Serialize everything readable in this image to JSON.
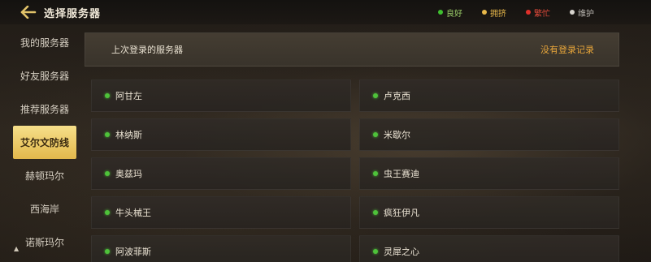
{
  "header": {
    "title": "选择服务器",
    "legend": [
      {
        "label": "良好",
        "color": "#3fbf2f"
      },
      {
        "label": "拥挤",
        "color": "#e8b84a"
      },
      {
        "label": "繁忙",
        "color": "#e0302a"
      },
      {
        "label": "维护",
        "color": "#d8d4ce"
      }
    ]
  },
  "sidebar": {
    "items": [
      {
        "label": "我的服务器"
      },
      {
        "label": "好友服务器"
      },
      {
        "label": "推荐服务器"
      },
      {
        "label": "艾尔文防线",
        "active": true
      },
      {
        "label": "赫顿玛尔"
      },
      {
        "label": "西海岸"
      },
      {
        "label": "诺斯玛尔"
      }
    ]
  },
  "last_login": {
    "label": "上次登录的服务器",
    "none": "没有登录记录"
  },
  "servers": [
    {
      "name": "阿甘左",
      "status": "良好"
    },
    {
      "name": "卢克西",
      "status": "良好"
    },
    {
      "name": "林纳斯",
      "status": "良好"
    },
    {
      "name": "米歇尔",
      "status": "良好"
    },
    {
      "name": "奥兹玛",
      "status": "良好"
    },
    {
      "name": "虫王赛迪",
      "status": "良好"
    },
    {
      "name": "牛头械王",
      "status": "良好"
    },
    {
      "name": "疯狂伊凡",
      "status": "良好"
    },
    {
      "name": "阿波菲斯",
      "status": "良好"
    },
    {
      "name": "灵犀之心",
      "status": "良好"
    }
  ]
}
